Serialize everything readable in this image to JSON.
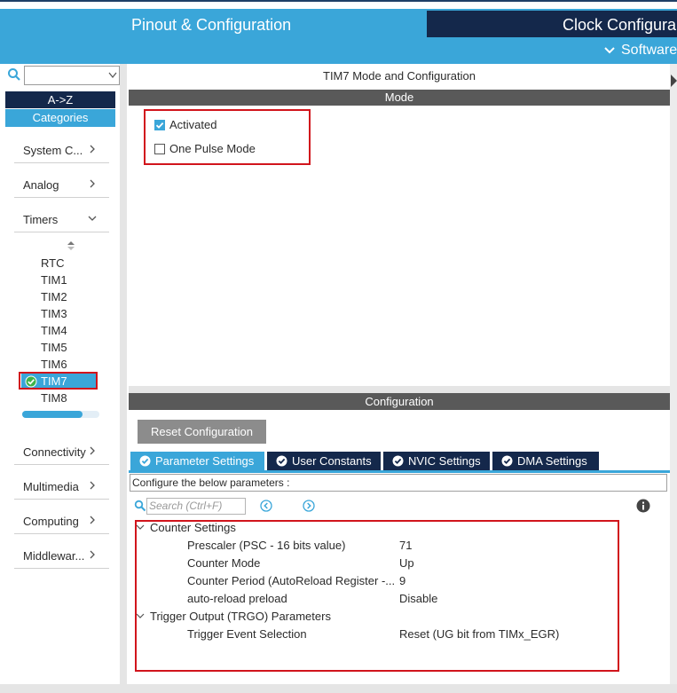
{
  "header": {
    "tabs": [
      {
        "label": "Pinout & Configuration",
        "active": true
      },
      {
        "label": "Clock Configura",
        "active": false
      }
    ],
    "software_menu": "Software"
  },
  "sidebar": {
    "search": {
      "value": ""
    },
    "sort_az": "A->Z",
    "categories_label": "Categories",
    "categories": [
      {
        "label": "System C..."
      },
      {
        "label": "Analog"
      },
      {
        "label": "Timers"
      },
      {
        "label": "Connectivity"
      },
      {
        "label": "Multimedia"
      },
      {
        "label": "Computing"
      },
      {
        "label": "Middlewar..."
      }
    ],
    "timers": [
      "RTC",
      "TIM1",
      "TIM2",
      "TIM3",
      "TIM4",
      "TIM5",
      "TIM6",
      "TIM7",
      "TIM8"
    ],
    "selected_timer": "TIM7"
  },
  "mode": {
    "title": "TIM7 Mode and Configuration",
    "section": "Mode",
    "options": [
      {
        "label": "Activated",
        "checked": true
      },
      {
        "label": "One Pulse Mode",
        "checked": false
      }
    ]
  },
  "configuration": {
    "section": "Configuration",
    "reset_label": "Reset Configuration",
    "tabs": [
      {
        "label": "Parameter Settings",
        "active": true
      },
      {
        "label": "User Constants",
        "active": false
      },
      {
        "label": "NVIC Settings",
        "active": false
      },
      {
        "label": "DMA Settings",
        "active": false
      }
    ],
    "hint": "Configure the below parameters :",
    "search_placeholder": "Search (Ctrl+F)",
    "groups": [
      {
        "name": "Counter Settings",
        "params": [
          {
            "name": "Prescaler (PSC - 16 bits value)",
            "value": "71"
          },
          {
            "name": "Counter Mode",
            "value": "Up"
          },
          {
            "name": "Counter Period (AutoReload Register -...",
            "value": "9"
          },
          {
            "name": "auto-reload preload",
            "value": "Disable"
          }
        ]
      },
      {
        "name": "Trigger Output (TRGO) Parameters",
        "params": [
          {
            "name": "Trigger Event Selection",
            "value": "Reset (UG bit from TIMx_EGR)"
          }
        ]
      }
    ]
  },
  "colors": {
    "accent": "#3aa6d9",
    "navy": "#14284b",
    "bar": "#595959",
    "highlight": "#d1141c"
  }
}
